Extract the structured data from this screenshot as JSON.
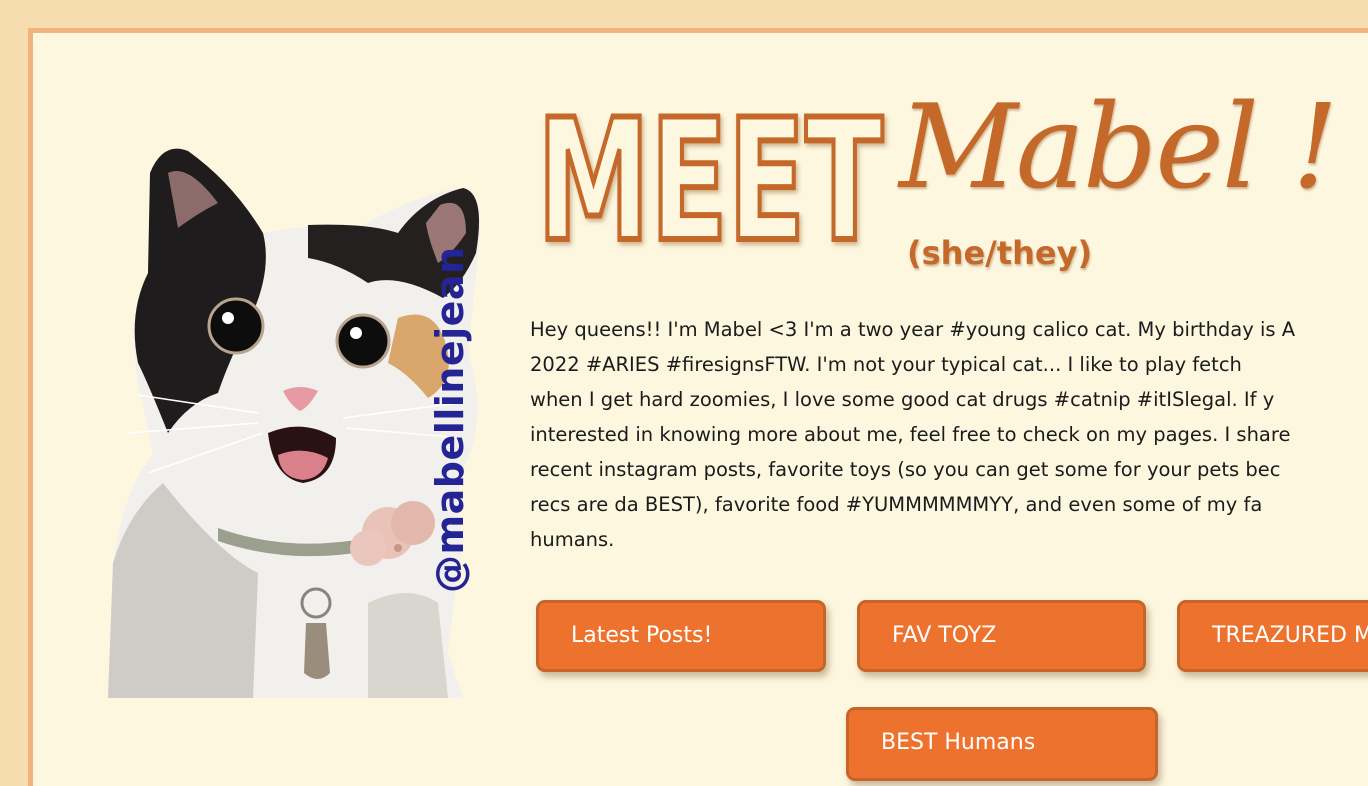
{
  "header": {
    "title_meet": "MEET",
    "title_name": "Mabel !",
    "pronouns": "(she/they)"
  },
  "profile": {
    "handle": "@mabellinejean",
    "photo": "calico-cat-photo"
  },
  "bio": {
    "lines": [
      "Hey queens!! I'm Mabel <3 I'm a two year #young calico cat. My birthday is A",
      "2022 #ARIES #firesignsFTW. I'm not your typical cat... I like to play fetch",
      "when I get hard zoomies, I love some good cat drugs #catnip #itISlegal. If y",
      "interested in knowing more about me, feel free to check on my pages. I share",
      "recent instagram posts, favorite toys (so you can get some for your pets bec",
      "recs are da BEST), favorite food #YUMMMMMMYY, and even some of my fa",
      "humans."
    ]
  },
  "nav": {
    "buttons": [
      "Latest Posts!",
      "FAV TOYZ",
      "TREAZURED M",
      "BEST Humans"
    ]
  },
  "colors": {
    "page_bg": "#f6ddb0",
    "panel_bg": "#fdf7df",
    "frame_border": "#eeb479",
    "title_orange": "#c4692a",
    "button_orange": "#ec722e",
    "handle_blue": "#242494"
  }
}
